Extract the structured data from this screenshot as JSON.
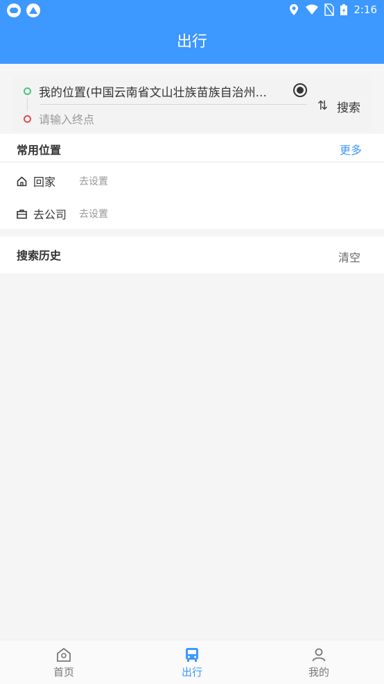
{
  "status_bar": {
    "time": "2:16",
    "left_icons": [
      "cloud-app-icon",
      "mountain-app-icon"
    ],
    "right_icons": [
      "location-icon",
      "wifi-icon",
      "no-sim-icon",
      "battery-icon"
    ]
  },
  "header": {
    "title": "出行"
  },
  "trip_search": {
    "start_value": "我的位置(中国云南省文山壮族苗族自治州...",
    "end_placeholder": "请输入终点",
    "swap_icon": "swap-icon",
    "search_label": "搜索"
  },
  "favorites": {
    "title": "常用位置",
    "more_label": "更多",
    "items": [
      {
        "icon": "home-icon",
        "label": "回家",
        "action": "去设置"
      },
      {
        "icon": "briefcase-icon",
        "label": "去公司",
        "action": "去设置"
      }
    ]
  },
  "history": {
    "title": "搜索历史",
    "clear_label": "清空"
  },
  "bottom_nav": {
    "items": [
      {
        "icon": "home-nav-icon",
        "label": "首页",
        "active": false
      },
      {
        "icon": "bus-icon",
        "label": "出行",
        "active": true
      },
      {
        "icon": "user-icon",
        "label": "我的",
        "active": false
      }
    ]
  },
  "colors": {
    "primary": "#3d98ff",
    "background": "#f5f5f5",
    "start_dot": "#4cc17e",
    "end_dot": "#e24a4a"
  }
}
